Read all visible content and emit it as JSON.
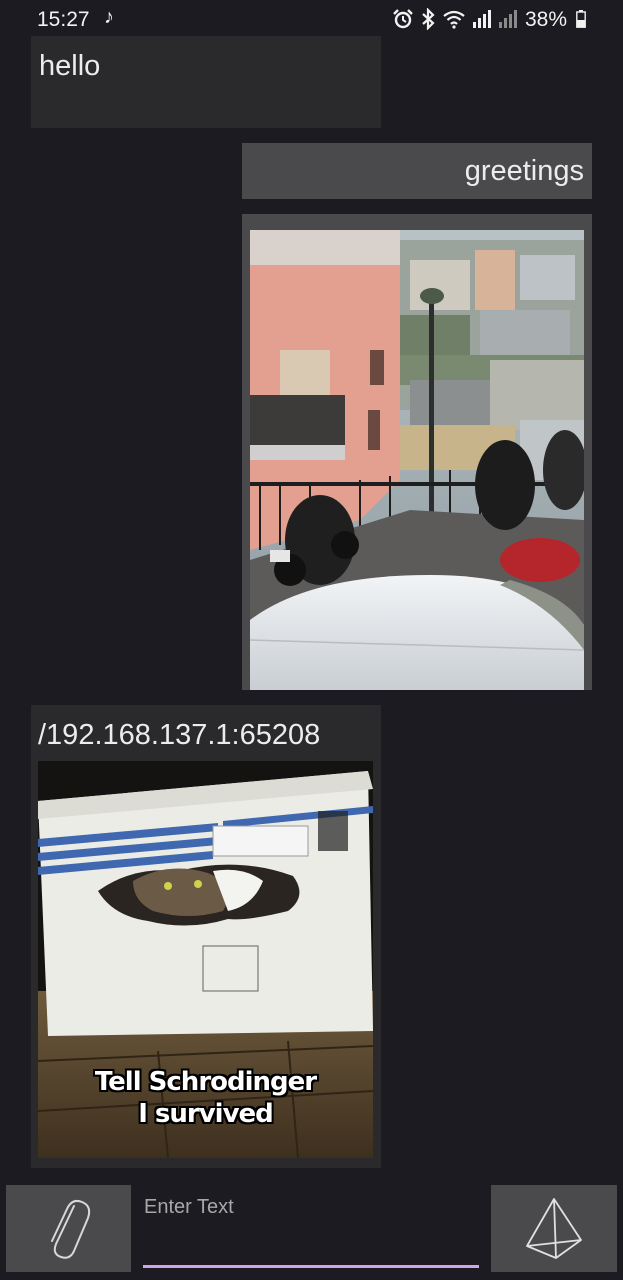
{
  "status_bar": {
    "time": "15:27",
    "battery_percent": "38%",
    "icons": [
      "music-note-icon",
      "alarm-icon",
      "bluetooth-icon",
      "wifi-icon",
      "signal-icon",
      "signal-icon",
      "battery-icon"
    ]
  },
  "messages": [
    {
      "direction": "in",
      "text": "hello"
    },
    {
      "direction": "out",
      "text": "greetings"
    },
    {
      "direction": "out",
      "type": "image"
    },
    {
      "direction": "in",
      "sender": "/192.168.137.1:65208",
      "type": "image",
      "image_caption": [
        "Tell Schrodinger",
        "I survived"
      ]
    }
  ],
  "composer": {
    "placeholder": "Enter Text",
    "value": "",
    "attach_icon": "paperclip-icon",
    "send_icon": "send-pyramid-icon"
  },
  "colors": {
    "background": "#1c1b21",
    "bubble_in": "#2a2a2c",
    "bubble_out": "#4a4a4c",
    "input_underline": "#c9a8e8"
  }
}
